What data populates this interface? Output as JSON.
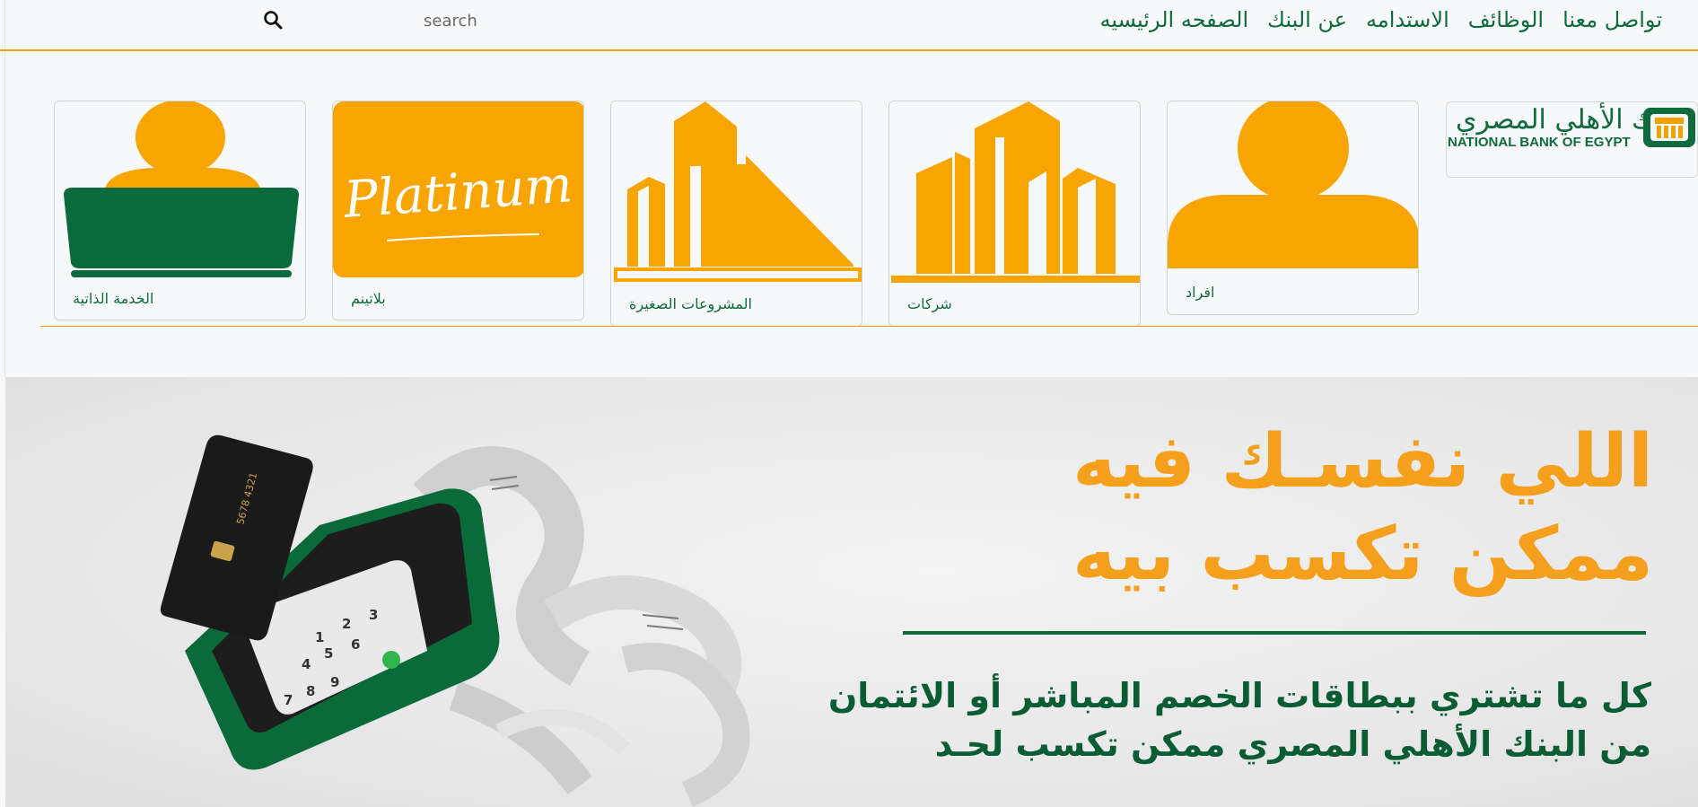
{
  "search": {
    "placeholder": "search",
    "icon": "search-icon"
  },
  "nav": {
    "links": [
      "تواصل معنا",
      "الوظائف",
      "الاستدامه",
      "عن البنك",
      "الصفحه الرئيسيه"
    ]
  },
  "logo": {
    "arabic": "البنك الأهلي المصري",
    "english": "NATIONAL BANK OF EGYPT"
  },
  "cards": [
    {
      "label": "افراد",
      "icon": "person-icon"
    },
    {
      "label": "شركات",
      "icon": "buildings-icon"
    },
    {
      "label": "المشروعات الصغيرة",
      "icon": "small-business-icon"
    },
    {
      "label": "بلاتينم",
      "icon": "platinum-icon",
      "icon_text": "Platinum"
    },
    {
      "label": "الخدمة الذاتية",
      "icon": "self-service-laptop-icon"
    }
  ],
  "banner": {
    "headline_line1": "اللي نفسـك فيه",
    "headline_line2": "ممكن تكسب بيه",
    "sub_line1": "كل ما تشتري ببطاقات الخصم المباشر أو الائتمان",
    "sub_line2": "من البنك الأهلي المصري ممكن تكسب لحـد"
  },
  "colors": {
    "brand_green": "#0f6b3d",
    "accent_orange": "#f0a201"
  }
}
